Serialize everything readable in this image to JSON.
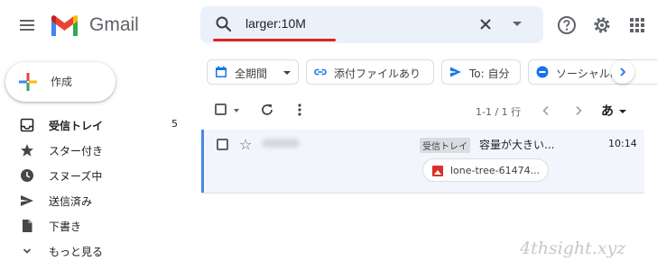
{
  "header": {
    "app_name": "Gmail",
    "search_query": "larger:10M"
  },
  "compose": {
    "label": "作成"
  },
  "sidebar": {
    "items": [
      {
        "label": "受信トレイ",
        "count": "5"
      },
      {
        "label": "スター付き"
      },
      {
        "label": "スヌーズ中"
      },
      {
        "label": "送信済み"
      },
      {
        "label": "下書き"
      },
      {
        "label": "もっと見る"
      }
    ]
  },
  "filters": {
    "chips": [
      {
        "label": "全期間",
        "icon": "calendar-icon"
      },
      {
        "label": "添付ファイルあり",
        "icon": "link-icon"
      },
      {
        "label": "To: 自分",
        "icon": "send-icon"
      },
      {
        "label": "ソーシャルめな",
        "icon": "social-icon"
      }
    ]
  },
  "toolbar": {
    "page_info": "1-1 / 1 行",
    "lang": "あ"
  },
  "emails": [
    {
      "label": "受信トレイ",
      "subject": "容量が大きい...",
      "time": "10:14",
      "attachment": "lone-tree-61474..."
    }
  ],
  "colors": {
    "accent": "#1a73e8",
    "search_bg": "#eaf1fb",
    "underline": "#e0241b",
    "row_border": "#4a86e8"
  },
  "watermark": "4thsight.xyz"
}
